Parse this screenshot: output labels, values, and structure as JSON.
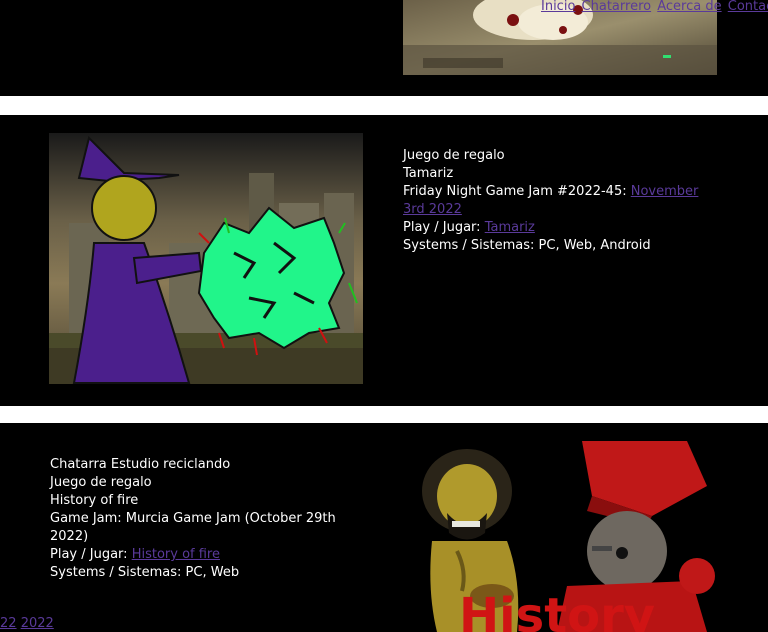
{
  "nav": {
    "items": [
      "Inicio",
      "Chatarrero",
      "Acerca de",
      "Contac"
    ]
  },
  "entry1": {
    "image_alt": "Game screenshot (cropped)"
  },
  "entry2": {
    "line1": "Juego de regalo",
    "line2": "Tamariz",
    "jam_prefix": "Friday Night Game Jam #2022-45: ",
    "jam_link": "November 3rd 2022",
    "play_prefix": "Play / Jugar: ",
    "play_link": "Tamariz",
    "systems": "Systems / Sistemas: PC, Web, Android"
  },
  "entry3": {
    "line1": "Chatarra Estudio reciclando",
    "line2": "Juego de regalo",
    "line3": "History of fire",
    "jam": "Game Jam: Murcia Game Jam (October 29th 2022)",
    "play_prefix": "Play / Jugar: ",
    "play_link": "History of fire",
    "systems": "Systems / Sistemas: PC, Web",
    "image_text": "History",
    "bottom_link_a": "22",
    "bottom_link_b": "2022"
  },
  "colors": {
    "link": "#5a3a9a",
    "background": "#000000",
    "separator": "#ffffff"
  }
}
